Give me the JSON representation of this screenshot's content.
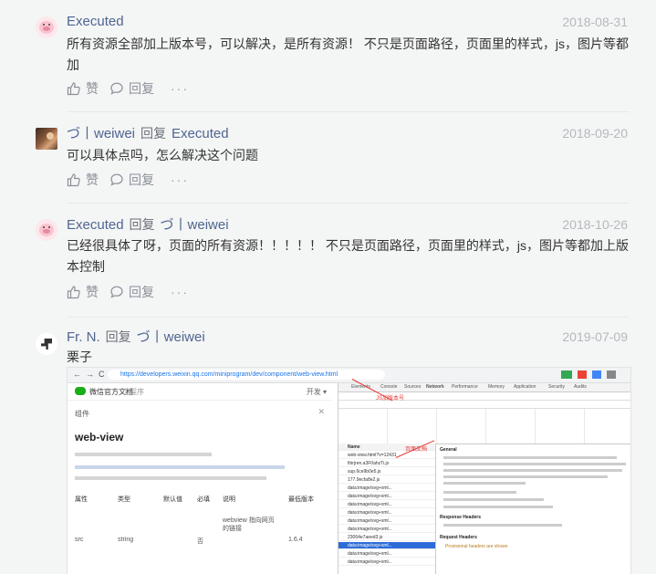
{
  "comments": [
    {
      "user": "Executed",
      "reply_word": "",
      "reply_to": "",
      "date": "2018-08-31",
      "lines": [
        "所有资源全部加上版本号，可以解决，是所有资源！ 不只是页面路径，页面里的样式，js，图片等都",
        "加"
      ],
      "like_label": "赞",
      "reply_label": "回复",
      "more": "···"
    },
    {
      "user": "づ丨weiwei",
      "reply_word": "回复",
      "reply_to": "Executed",
      "date": "2018-09-20",
      "lines": [
        "可以具体点吗，怎么解决这个问题"
      ],
      "like_label": "赞",
      "reply_label": "回复",
      "more": "···"
    },
    {
      "user": "Executed",
      "reply_word": "回复",
      "reply_to": "づ丨weiwei",
      "date": "2018-10-26",
      "lines": [
        "已经很具体了呀，页面的所有资源！！！！！ 不只是页面路径，页面里的样式，js，图片等都加上版",
        "本控制"
      ],
      "like_label": "赞",
      "reply_label": "回复",
      "more": "···"
    },
    {
      "user": "Fr. N.",
      "reply_word": "回复",
      "reply_to": "づ丨weiwei",
      "date": "2019-07-09",
      "lines": [
        "栗子"
      ]
    }
  ],
  "screenshot": {
    "url": "https://developers.weixin.qq.com/miniprogram/dev/component/web-view.html",
    "site_title": "微信官方文档",
    "site_sub": "小程序",
    "open_label": "开发 ▾",
    "breadcrumb": "组件",
    "heading": "web-view",
    "table_headers": [
      "属性",
      "类型",
      "默认值",
      "必填",
      "说明",
      "最低版本"
    ],
    "row": [
      "src",
      "string",
      "",
      "否",
      "webview 指向网页的链接",
      "1.6.4"
    ],
    "devtools_tabs": [
      "Elements",
      "Console",
      "Sources",
      "Network",
      "Performance",
      "Memory",
      "Application",
      "Security",
      "Audits"
    ],
    "list_header": "Name",
    "requests": [
      "web-view.html?v=12431",
      "thirjren.a3F0ahzTi.js",
      "sup.6ce9b0e5.js",
      "177.9ecfa8e2.js",
      "data:image/svg+xml...",
      "data:image/svg+xml...",
      "data:image/svg+xml...",
      "data:image/svg+xml...",
      "data:image/svg+xml...",
      "data:image/svg+xml...",
      "23064e7aeed3.js",
      "data:image/svg+xml...",
      "data:image/svg+xml...",
      "data:image/svg+xml..."
    ],
    "detail_sections": [
      "General",
      "Response Headers",
      "Request Headers"
    ],
    "detail_note": "Provisional headers are shown",
    "annotation_1": "JS加版本号",
    "annotation_2": "页面文档"
  }
}
